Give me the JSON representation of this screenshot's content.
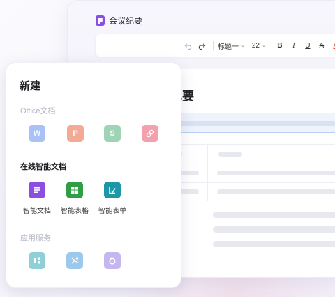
{
  "document": {
    "title": "会议纪要",
    "heading": "会议纪要",
    "toolbar": {
      "undo_icon": "undo-icon",
      "redo_icon": "redo-icon",
      "style_select": "标题一",
      "size_select": "22",
      "bold": "B",
      "italic": "I",
      "underline": "U",
      "strikethrough": "A",
      "color": "A"
    }
  },
  "panel": {
    "title": "新建",
    "sections": {
      "office": {
        "label": "Office文档",
        "items": [
          {
            "letter": "W",
            "icon": "word-icon",
            "color": "#a8c2f5"
          },
          {
            "letter": "P",
            "icon": "powerpoint-icon",
            "color": "#f3a994"
          },
          {
            "letter": "S",
            "icon": "spreadsheet-icon",
            "color": "#9ed4b4"
          },
          {
            "letter": "",
            "icon": "pdf-icon",
            "color": "#f3a1ad"
          }
        ]
      },
      "online": {
        "label": "在线智能文档",
        "items": [
          {
            "label": "智能文档",
            "icon": "smart-document-icon",
            "color": "#8a4fe0"
          },
          {
            "label": "智能表格",
            "icon": "smart-table-icon",
            "color": "#2f9e44"
          },
          {
            "label": "智能表单",
            "icon": "smart-form-icon",
            "color": "#1b97a6"
          }
        ]
      },
      "apps": {
        "label": "应用服务",
        "items": [
          {
            "icon": "flowchart-app-icon",
            "color": "#8ed0d6"
          },
          {
            "icon": "mindmap-app-icon",
            "color": "#9cc8ec"
          },
          {
            "icon": "whiteboard-app-icon",
            "color": "#c5b6f0"
          }
        ]
      }
    }
  }
}
